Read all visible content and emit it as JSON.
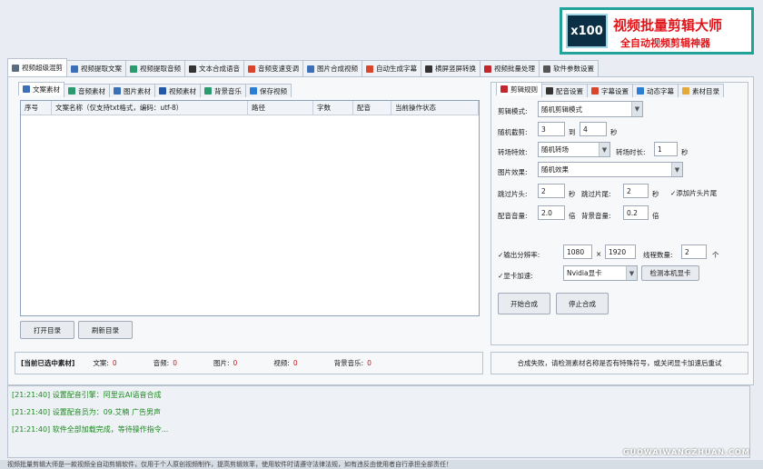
{
  "banner": {
    "logo_text": "x100",
    "title": "视频批量剪辑大师",
    "subtitle": "全自动视频剪辑神器"
  },
  "main_tabs": [
    {
      "label": "视频超级混剪",
      "icon": "scissors-icon",
      "color": "#5a6c80"
    },
    {
      "label": "视频提取文案",
      "icon": "document-icon",
      "color": "#3b6fb6"
    },
    {
      "label": "视频提取音频",
      "icon": "audio-icon",
      "color": "#2b9a6e"
    },
    {
      "label": "文本合成语音",
      "icon": "microphone-icon",
      "color": "#333333"
    },
    {
      "label": "音频变速变调",
      "icon": "gauge-icon",
      "color": "#d9452b"
    },
    {
      "label": "图片合成视频",
      "icon": "picture-icon",
      "color": "#3b6fb6"
    },
    {
      "label": "自动生成字幕",
      "icon": "font-icon",
      "color": "#d9452b"
    },
    {
      "label": "横屏竖屏转换",
      "icon": "rotate-icon",
      "color": "#333333"
    },
    {
      "label": "视频批量处理",
      "icon": "film-icon",
      "color": "#c2272d"
    },
    {
      "label": "软件参数设置",
      "icon": "gear-icon",
      "color": "#555555"
    }
  ],
  "sub_tabs": [
    {
      "label": "文案素材",
      "icon": "document-icon",
      "color": "#3b6fb6"
    },
    {
      "label": "音频素材",
      "icon": "audio-icon",
      "color": "#2b9a6e"
    },
    {
      "label": "图片素材",
      "icon": "picture-icon",
      "color": "#3b6fb6"
    },
    {
      "label": "视频素材",
      "icon": "play-icon",
      "color": "#2456a8"
    },
    {
      "label": "背景音乐",
      "icon": "music-icon",
      "color": "#2b9a6e"
    },
    {
      "label": "保存视频",
      "icon": "save-icon",
      "color": "#2a7fd4"
    }
  ],
  "table": {
    "columns": [
      "序号",
      "文案名称（仅支持txt格式，编码：utf-8）",
      "路径",
      "字数",
      "配音",
      "当前操作状态"
    ]
  },
  "buttons": {
    "open_dir": "打开目录",
    "refresh_dir": "刷新目录",
    "start": "开始合成",
    "stop": "停止合成",
    "detect_gpu": "检测本机显卡"
  },
  "status": {
    "title": "[当前已选中素材]",
    "items": [
      {
        "label": "文案:",
        "count": "0"
      },
      {
        "label": "音频:",
        "count": "0"
      },
      {
        "label": "图片:",
        "count": "0"
      },
      {
        "label": "视频:",
        "count": "0"
      },
      {
        "label": "背景音乐:",
        "count": "0"
      }
    ]
  },
  "right_tabs": [
    {
      "label": "剪辑规则",
      "icon": "film-icon",
      "color": "#c2272d"
    },
    {
      "label": "配音设置",
      "icon": "microphone-icon",
      "color": "#333333"
    },
    {
      "label": "字幕设置",
      "icon": "font-icon",
      "color": "#d9452b"
    },
    {
      "label": "动态字幕",
      "icon": "text-icon",
      "color": "#2a7fd4"
    },
    {
      "label": "素材目录",
      "icon": "folder-icon",
      "color": "#e5a83a"
    }
  ],
  "settings": {
    "mode_label": "剪辑模式:",
    "mode_value": "随机剪辑模式",
    "clip_label": "随机截剪:",
    "clip_min": "3",
    "clip_to": "到",
    "clip_max": "4",
    "clip_unit": "秒",
    "trans_label": "转场特效:",
    "trans_value": "随机转场",
    "trans_dur_label": "转场时长:",
    "trans_dur": "1",
    "trans_dur_unit": "秒",
    "img_label": "图片效果:",
    "img_value": "随机效果",
    "skip_head_label": "跳过片头:",
    "skip_head": "2",
    "skip_head_unit": "秒",
    "skip_tail_label": "跳过片尾:",
    "skip_tail": "2",
    "skip_tail_unit": "秒",
    "add_head_label": "添加片头片尾",
    "voice_vol_label": "配音音量:",
    "voice_vol": "2.0",
    "voice_vol_unit": "倍",
    "bgm_vol_label": "背景音量:",
    "bgm_vol": "0.2",
    "bgm_vol_unit": "倍",
    "res_label": "输出分辨率:",
    "res_w": "1080",
    "res_x": "×",
    "res_h": "1920",
    "threads_label": "线程数量:",
    "threads": "2",
    "threads_unit": "个",
    "gpu_label": "显卡加速:",
    "gpu_value": "Nvidia显卡"
  },
  "message": "合成失败，请检测素材名称是否有特殊符号，或关闭显卡加速后重试",
  "log": [
    "[21:21:40] 设置配音引擎：阿里云AI语音合成",
    "[21:21:40] 设置配音员为：09.艾楠 广告男声",
    "[21:21:40] 软件全部加载完成，等待操作指令..."
  ],
  "footer": "视频批量剪辑大师是一款视频全自动剪辑软件，仅用于个人原创视频制作，提高剪辑效率，使用软件时请遵守法律法规，如有违反由使用者自行承担全部责任！",
  "watermark": "GUOWAIWANGZHUAN.COM"
}
